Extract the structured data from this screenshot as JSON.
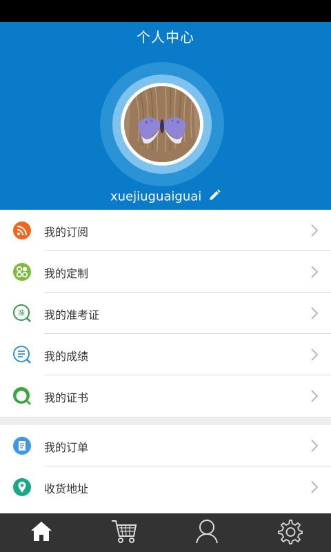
{
  "header": {
    "title": "个人中心",
    "username": "xuejiuguaiguai",
    "background_color": "#0a7bc8"
  },
  "menu": {
    "groups": [
      {
        "items": [
          {
            "label": "我的订阅",
            "icon": "rss-icon",
            "color": "#f0651f"
          },
          {
            "label": "我的定制",
            "icon": "customize-icon",
            "color": "#7dbb3a"
          },
          {
            "label": "我的准考证",
            "icon": "admission-ticket-icon",
            "color": "#2e9b4a"
          },
          {
            "label": "我的成绩",
            "icon": "scores-icon",
            "color": "#2f8fd8"
          },
          {
            "label": "我的证书",
            "icon": "certificate-icon",
            "color": "#3aa640"
          }
        ]
      },
      {
        "items": [
          {
            "label": "我的订单",
            "icon": "order-icon",
            "color": "#3f97e6"
          },
          {
            "label": "收货地址",
            "icon": "location-icon",
            "color": "#1aa688"
          }
        ]
      }
    ]
  },
  "tabbar": {
    "tabs": [
      {
        "name": "home",
        "icon": "home-icon",
        "active": true
      },
      {
        "name": "cart",
        "icon": "cart-icon",
        "active": false
      },
      {
        "name": "profile",
        "icon": "user-icon",
        "active": false
      },
      {
        "name": "settings",
        "icon": "gear-icon",
        "active": false
      }
    ]
  }
}
